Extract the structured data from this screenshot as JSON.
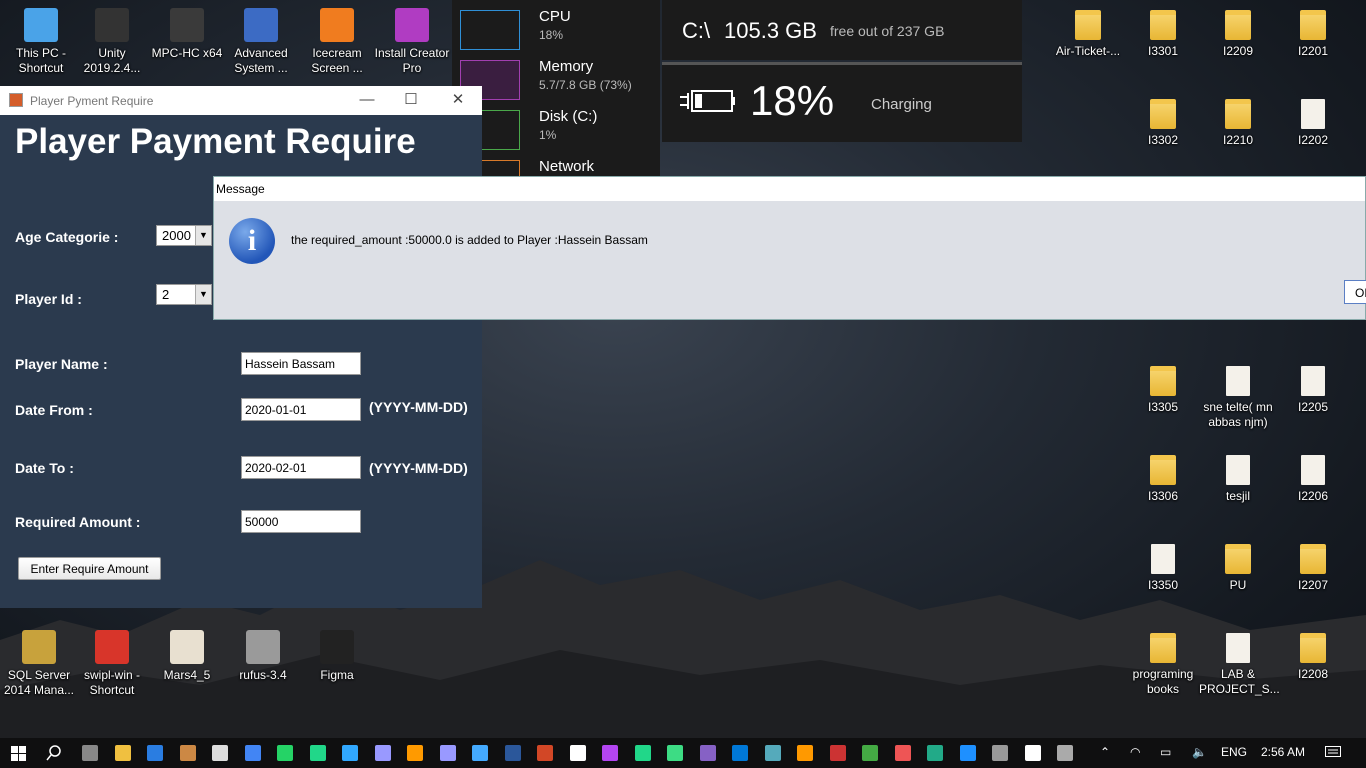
{
  "desktop_icons_left": [
    {
      "label": "This PC - Shortcut",
      "color": "#4aa3e8"
    },
    {
      "label": "Unity 2019.2.4...",
      "color": "#333333"
    },
    {
      "label": "MPC-HC x64",
      "color": "#3a3a3a"
    },
    {
      "label": "Advanced System ...",
      "color": "#3c6bc4"
    },
    {
      "label": "Icecream Screen ...",
      "color": "#f07c1f"
    },
    {
      "label": "Install Creator Pro",
      "color": "#b03cc2"
    }
  ],
  "desktop_icons_bottom": [
    {
      "label": "SQL Server 2014 Mana...",
      "color": "#c8a23c"
    },
    {
      "label": "swipl-win - Shortcut",
      "color": "#d8352a"
    },
    {
      "label": "Mars4_5",
      "color": "#e8e0d0"
    },
    {
      "label": "rufus-3.4",
      "color": "#9a9a9a"
    },
    {
      "label": "Figma",
      "color": "#222222"
    }
  ],
  "desktop_icons_right": [
    {
      "label": "Air-Ticket-...",
      "kind": "folder"
    },
    {
      "label": "I3301",
      "kind": "folder"
    },
    {
      "label": "I2209",
      "kind": "folder"
    },
    {
      "label": "I2201",
      "kind": "folder"
    },
    {
      "label": "I3302",
      "kind": "folder"
    },
    {
      "label": "I2210",
      "kind": "folder"
    },
    {
      "label": "I2202",
      "kind": "doc"
    },
    {
      "label": "I3305",
      "kind": "folder"
    },
    {
      "label": "sne telte( mn abbas njm)",
      "kind": "doc"
    },
    {
      "label": "I2205",
      "kind": "doc"
    },
    {
      "label": "I3306",
      "kind": "folder"
    },
    {
      "label": "tesjil",
      "kind": "doc"
    },
    {
      "label": "I2206",
      "kind": "doc"
    },
    {
      "label": "I3350",
      "kind": "doc"
    },
    {
      "label": "PU",
      "kind": "folder"
    },
    {
      "label": "I2207",
      "kind": "folder"
    },
    {
      "label": "programing books",
      "kind": "folder"
    },
    {
      "label": "LAB & PROJECT_S...",
      "kind": "doc"
    },
    {
      "label": "I2208",
      "kind": "folder"
    }
  ],
  "system_widget": {
    "cpu": {
      "name": "CPU",
      "value": "18%"
    },
    "memory": {
      "name": "Memory",
      "value": "5.7/7.8 GB (73%)"
    },
    "disk": {
      "name": "Disk (C:)",
      "value": "1%"
    },
    "network": {
      "name": "Network"
    }
  },
  "disk_widget": {
    "drive": "C:\\",
    "free": "105.3 GB",
    "suffix": "free out of 237 GB"
  },
  "battery_widget": {
    "percent": "18%",
    "status": "Charging"
  },
  "app_window": {
    "title_bar": "Player Pyment Require",
    "heading": "Player Payment Require",
    "age_label": "Age Categorie :",
    "age_value": "2000",
    "player_id_label": "Player Id :",
    "player_id_value": "2",
    "player_name_label": "Player Name :",
    "player_name_value": "Hassein Bassam",
    "date_from_label": "Date From :",
    "date_from_value": "2020-01-01",
    "date_to_label": "Date To :",
    "date_to_value": "2020-02-01",
    "date_hint": "(YYYY-MM-DD)",
    "amount_label": "Required Amount :",
    "amount_value": "50000",
    "submit_label": "Enter Require Amount",
    "minimize": "—",
    "maximize": "☐",
    "close": "✕"
  },
  "message_dialog": {
    "title": "Message",
    "icon": "i",
    "text": "the required_amount :50000.0 is added to Player :Hassein Bassam",
    "ok_label": "OK"
  },
  "taskbar": {
    "language": "ENG",
    "time": "2:56 AM"
  }
}
